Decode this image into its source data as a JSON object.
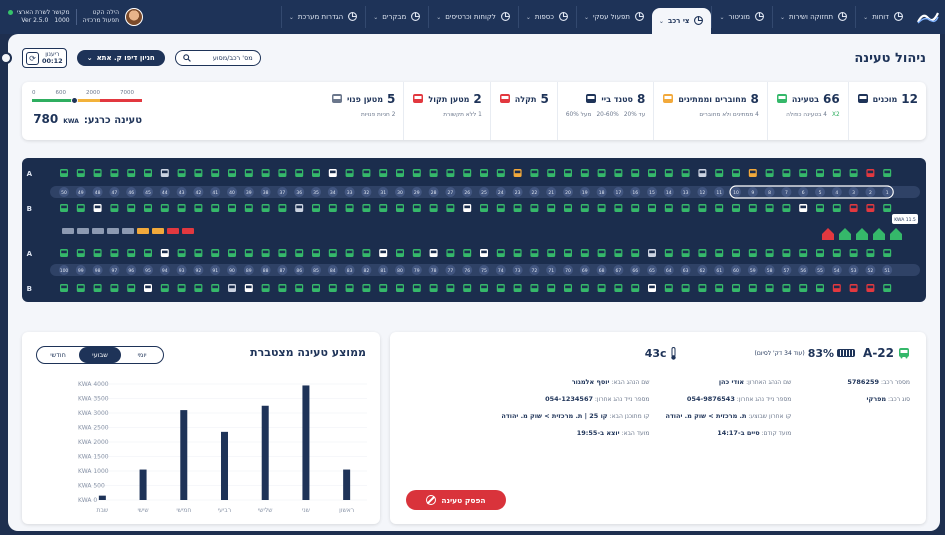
{
  "topbar": {
    "tabs": [
      {
        "label": "דוחות",
        "icon": "pie-chart-icon"
      },
      {
        "label": "תחזוקה ושירות",
        "icon": "headset-icon"
      },
      {
        "label": "מוניטור",
        "icon": "pulse-icon"
      },
      {
        "label": "צי רכב",
        "icon": "search-bus-icon",
        "active": true
      },
      {
        "label": "תפעול עסקי",
        "icon": "gear-icon"
      },
      {
        "label": "כספות",
        "icon": "safe-icon"
      },
      {
        "label": "לקוחות וכרטיסים",
        "icon": "card-icon"
      },
      {
        "label": "מבקרים",
        "icon": "visitors-icon"
      },
      {
        "label": "הגדרות מערכת",
        "icon": "sliders-icon"
      }
    ],
    "user": {
      "name": "הילה הקט",
      "role": "תפעול מרכזיה"
    },
    "connection": {
      "status": "מקושר לשרת הארצי",
      "version": "Ver 2.5.0",
      "code": "1000"
    }
  },
  "header": {
    "title": "ניהול טעינה",
    "search_label": "מס' רכב/מסוע",
    "depot_label": "חניון דיפו ק. אתא",
    "refresh_label": "ריענון",
    "refresh_time": "00:12"
  },
  "stats": [
    {
      "id": "docked",
      "num": "12",
      "label": "מוכנים",
      "sub": []
    },
    {
      "id": "charging",
      "num": "66",
      "label": "בטעינה",
      "sub": [
        {
          "v": "X2",
          "green": true
        },
        {
          "v": "4 בטעינה כפולה"
        }
      ]
    },
    {
      "id": "connected",
      "num": "8",
      "label": "מחוברים וממתינים",
      "sub": [
        {
          "v": "4 ממתינים ולא מחוברים"
        }
      ]
    },
    {
      "id": "standby",
      "num": "8",
      "label": "סטנד ביי",
      "sub": [
        {
          "v": "עד 20%"
        },
        {
          "v": "20-60%"
        },
        {
          "v": "מעל 60%"
        }
      ]
    },
    {
      "id": "fault",
      "num": "5",
      "label": "תקלה",
      "sub": []
    },
    {
      "id": "charger_fault",
      "num": "2",
      "label": "מטען תקול",
      "sub": [
        {
          "v": "1 ללא תקשורת"
        }
      ]
    },
    {
      "id": "free_charger",
      "num": "5",
      "label": "מטען פנוי",
      "sub": [
        {
          "v": "2 חניות פנויות"
        }
      ]
    }
  ],
  "charge": {
    "scale": [
      "0",
      "600",
      "2000",
      "7000"
    ],
    "label": "טעינה כרגע:",
    "unit": "KWA",
    "value": "780",
    "level": 0.38
  },
  "yard": {
    "row_letters": [
      "A",
      "B",
      "A",
      "B"
    ],
    "slot_labels_top": [
      "1",
      "2",
      "3",
      "4",
      "5",
      "6",
      "7",
      "8",
      "9",
      "10",
      "11",
      "12",
      "13",
      "14",
      "15",
      "16",
      "17",
      "18",
      "19",
      "20",
      "21",
      "22",
      "23",
      "24",
      "25",
      "26",
      "27",
      "28",
      "29",
      "30",
      "31",
      "32",
      "33",
      "34",
      "35",
      "36",
      "37",
      "38",
      "39",
      "40",
      "41",
      "42",
      "43",
      "44",
      "45",
      "46",
      "47",
      "48",
      "49",
      "50"
    ],
    "slot_labels_bottom": [
      "51",
      "52",
      "53",
      "54",
      "55",
      "56",
      "57",
      "58",
      "59",
      "60",
      "61",
      "62",
      "63",
      "64",
      "65",
      "66",
      "67",
      "68",
      "69",
      "70",
      "71",
      "72",
      "73",
      "74",
      "75",
      "76",
      "77",
      "78",
      "79",
      "80",
      "81",
      "82",
      "83",
      "84",
      "85",
      "86",
      "87",
      "88",
      "89",
      "90",
      "91",
      "92",
      "93",
      "94",
      "95",
      "96",
      "97",
      "98",
      "99",
      "100"
    ],
    "tooltip": "11.5 KWA",
    "x2_label": "X2",
    "colors": {
      "green": "#35b86a",
      "orange": "#f2a93b",
      "red": "#e2383f",
      "white": "#ffffff",
      "slate": "#cbd3e1"
    },
    "row1": "GRGGGGGGOGGZGGGGGGGGGGOGGGGGGGGGGWGGGGGGGGGZGGGGGG",
    "row2": "GRRGGWGGGGGGGGGGGGGGGGGGGWGGGGGGGGGZGGGGGGGGGGGWGG",
    "row3": "GGGGGGGGGGGGGGZGGGGGGGGGWGGWGGWGGGGGGGGGGGGWGGGGGG",
    "row4": "GRRRGGGGGGGGGGWGGGGGGGGGGGGGGGGGGGGGGGWZGGGGWGGGGG"
  },
  "chart": {
    "title": "ממוצע טעינה מצטברת",
    "tabs": [
      "יומי",
      "שבועי",
      "חודשי"
    ],
    "active_tab": "שבועי"
  },
  "chart_data": {
    "type": "bar",
    "title": "ממוצע טעינה מצטברת",
    "categories": [
      "שבת",
      "שישי",
      "חמישי",
      "רביעי",
      "שלישי",
      "שני",
      "ראשון"
    ],
    "values": [
      150,
      1050,
      3100,
      2350,
      3250,
      3950,
      1050
    ],
    "yticks": [
      "0 KWA",
      "500 KWA",
      "1000 KWA",
      "1500 KWA",
      "2000 KWA",
      "2500 KWA",
      "3000 KWA",
      "3500 KWA",
      "4000 KWA"
    ],
    "ylim": [
      0,
      4000
    ],
    "color": "#1e3358"
  },
  "bus": {
    "id": "A-22",
    "battery": "83%",
    "battery_note": "(עוד 34 דק' לסיום)",
    "temp": "43c",
    "col1": [
      {
        "k": "מספר רכב:",
        "v": "5786259"
      },
      {
        "k": "סוג רכב:",
        "v": "מפרקי"
      }
    ],
    "col2": [
      {
        "k": "שם הנהג האחרון:",
        "v": "אודי כהן"
      },
      {
        "k": "מספר נייד נהג אחרון:",
        "v": "054-9876543"
      },
      {
        "k": "קו אחרון שבוצע:",
        "v": "ת. מרכזית > שוק מ. יהודה"
      },
      {
        "k": "מועד קודם:",
        "v": "סיים ב-14:17"
      }
    ],
    "col3": [
      {
        "k": "שם הנהג הבא:",
        "v": "יוסף אלמגור"
      },
      {
        "k": "מספר נייד נהג אחרון:",
        "v": "054-1234567"
      },
      {
        "k": "קו מתוכנן הבא:",
        "v": "קו 25 | ת. מרכזית > שוק מ. יהודה"
      },
      {
        "k": "מועד הבא:",
        "v": "יוצא ב-19:55"
      }
    ],
    "stop_label": "הפסק טעינה"
  }
}
